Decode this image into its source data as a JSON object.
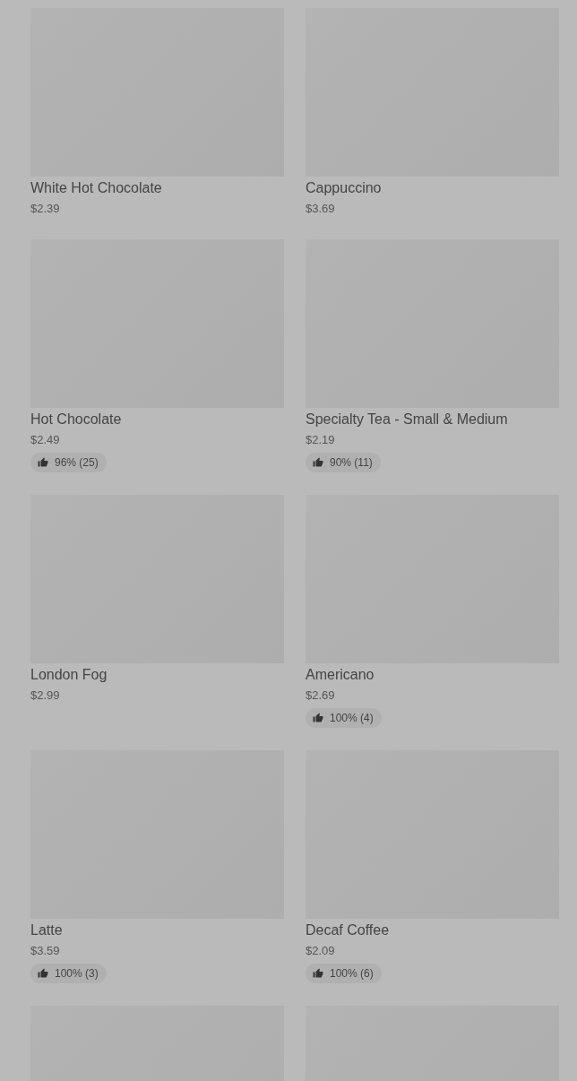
{
  "items": [
    {
      "kind": "product",
      "name": "White Hot Chocolate",
      "price": "$2.39"
    },
    {
      "kind": "product",
      "name": "Cappuccino",
      "price": "$3.69"
    },
    {
      "kind": "product",
      "name": "Hot Chocolate",
      "price": "$2.49",
      "rating": "96% (25)"
    },
    {
      "kind": "product",
      "name": "Specialty Tea - Small & Medium",
      "price": "$2.19",
      "rating": "90% (11)"
    },
    {
      "kind": "product",
      "name": "London Fog",
      "price": "$2.99"
    },
    {
      "kind": "product",
      "name": "Americano",
      "price": "$2.69",
      "rating": "100% (4)"
    },
    {
      "kind": "product",
      "name": "Latte",
      "price": "$3.59",
      "rating": "100% (3)"
    },
    {
      "kind": "product",
      "name": "Decaf Coffee",
      "price": "$2.09",
      "rating": "100% (6)"
    },
    {
      "kind": "image"
    },
    {
      "kind": "image"
    }
  ]
}
